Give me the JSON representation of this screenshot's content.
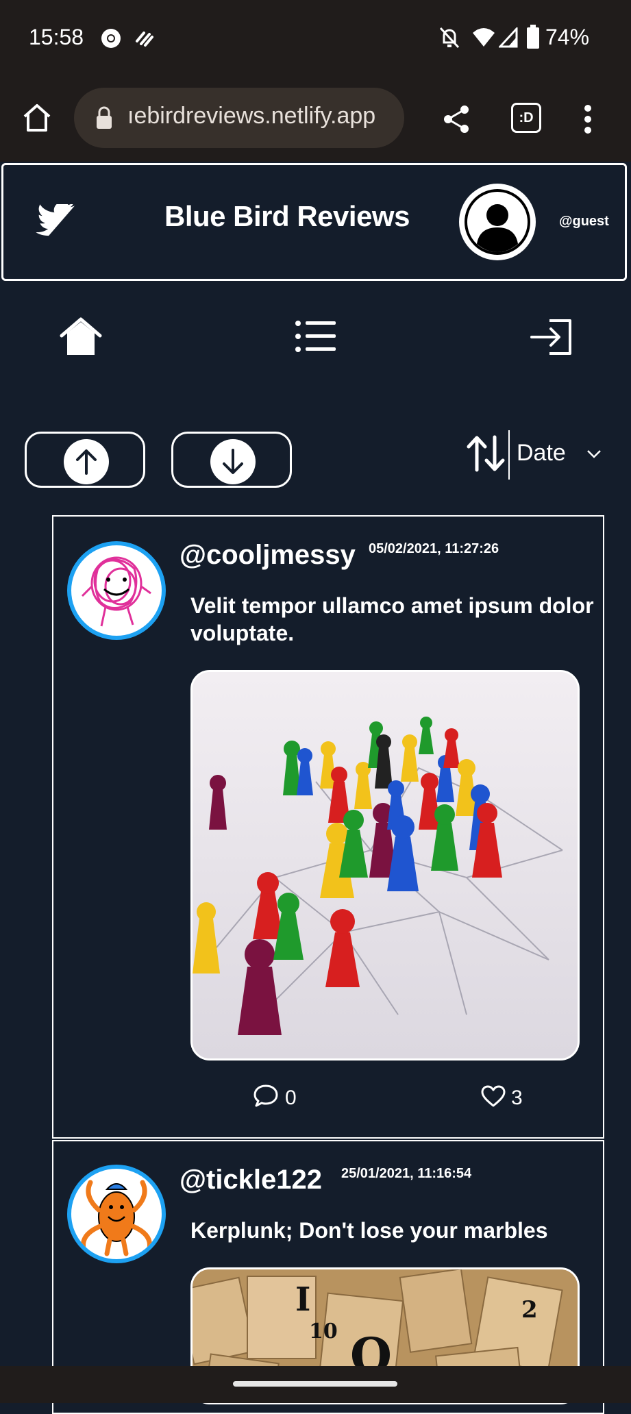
{
  "status_bar": {
    "time": "15:58",
    "battery": "74%"
  },
  "browser": {
    "url": "ıebirdreviews.netlify.app",
    "tab_label": ":D"
  },
  "header": {
    "title": "Blue Bird Reviews",
    "username": "@guest"
  },
  "sort": {
    "label": "Date"
  },
  "posts": [
    {
      "handle": "@cooljmessy",
      "date": "05/02/2021, 11:27:26",
      "text": "Velit tempor ullamco amet ipsum dolor voluptate.",
      "comments": "0",
      "likes": "3"
    },
    {
      "handle": "@tickle122",
      "date": "25/01/2021, 11:16:54",
      "text": "Kerplunk; Don't lose your marbles"
    }
  ],
  "colors": {
    "background": "#141d2b",
    "accent": "#1da1f2",
    "chrome": "#201c1b"
  }
}
